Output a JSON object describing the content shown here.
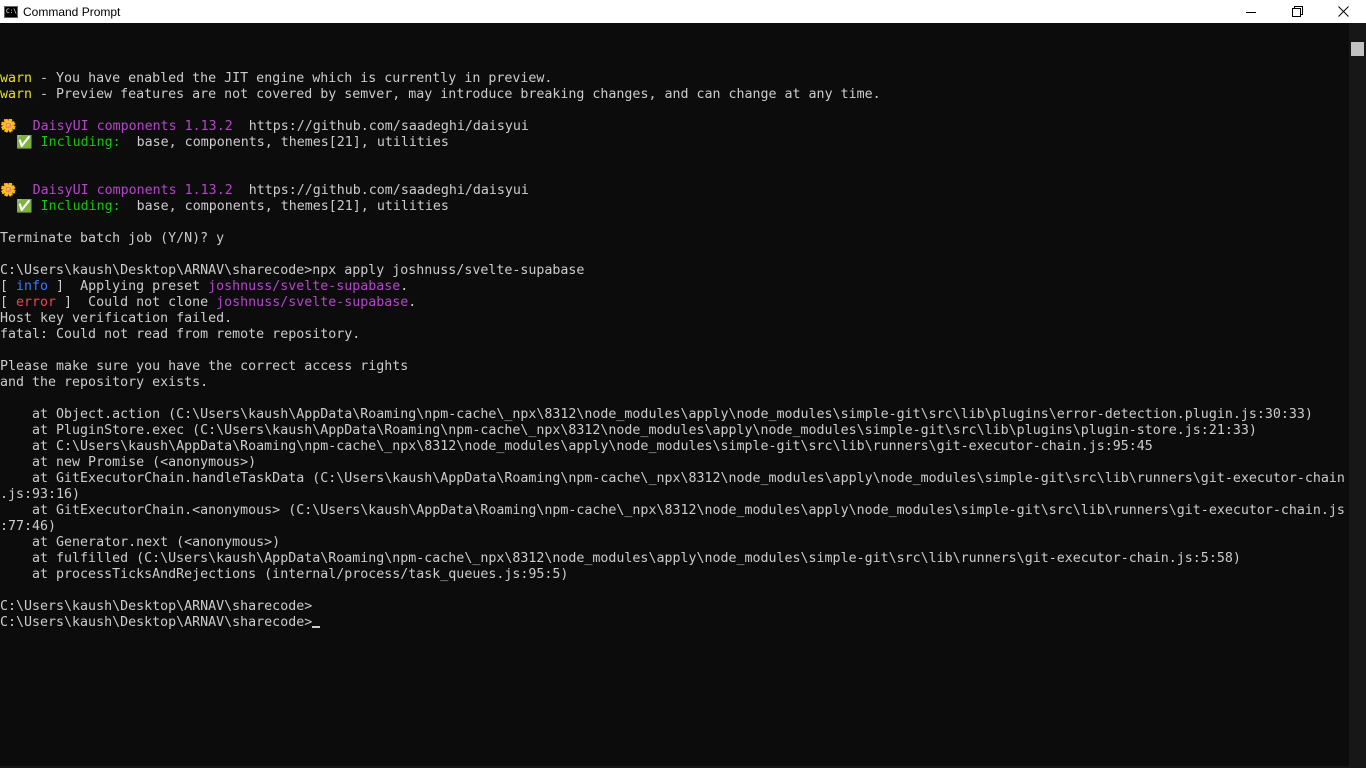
{
  "window": {
    "title": "Command Prompt",
    "icon": "cmd-icon",
    "icon_text": "C:\\",
    "controls": [
      "minimize-icon",
      "restore-icon",
      "close-icon"
    ]
  },
  "colors": {
    "background": "#0c0c0c",
    "text": "#cccccc",
    "warn": "#e5e510",
    "purple": "#b148c6",
    "green": "#16c60c",
    "blue": "#3b78ff",
    "red": "#e74856"
  },
  "console": {
    "lines": [
      [
        {
          "t": "warn",
          "c": "warn"
        },
        {
          "t": " - You have enabled the JIT engine which is currently in preview."
        }
      ],
      [
        {
          "t": "warn",
          "c": "warn"
        },
        {
          "t": " - Preview features are not covered by semver, may introduce breaking changes, and can change at any time."
        }
      ],
      [],
      [
        {
          "t": "🌼  DaisyUI components 1.13.2",
          "c": "purple"
        },
        {
          "t": "  https://github.com/saadeghi/daisyui"
        }
      ],
      [
        {
          "t": "  ✅ Including:",
          "c": "green"
        },
        {
          "t": "  base, components, themes[21], utilities"
        }
      ],
      [],
      [],
      [
        {
          "t": "🌼  DaisyUI components 1.13.2",
          "c": "purple"
        },
        {
          "t": "  https://github.com/saadeghi/daisyui"
        }
      ],
      [
        {
          "t": "  ✅ Including:",
          "c": "green"
        },
        {
          "t": "  base, components, themes[21], utilities"
        }
      ],
      [],
      [
        {
          "t": "Terminate batch job (Y/N)? y"
        }
      ],
      [],
      [
        {
          "t": "C:\\Users\\kaush\\Desktop\\ARNAV\\sharecode>npx apply joshnuss/svelte-supabase"
        }
      ],
      [
        {
          "t": "[ "
        },
        {
          "t": "info",
          "c": "blue"
        },
        {
          "t": " ]  Applying preset "
        },
        {
          "t": "joshnuss/svelte-supabase",
          "c": "purple"
        },
        {
          "t": "."
        }
      ],
      [
        {
          "t": "[ "
        },
        {
          "t": "error",
          "c": "red"
        },
        {
          "t": " ]  Could not clone "
        },
        {
          "t": "joshnuss/svelte-supabase",
          "c": "purple"
        },
        {
          "t": "."
        }
      ],
      [
        {
          "t": "Host key verification failed."
        }
      ],
      [
        {
          "t": "fatal: Could not read from remote repository."
        }
      ],
      [],
      [
        {
          "t": "Please make sure you have the correct access rights"
        }
      ],
      [
        {
          "t": "and the repository exists."
        }
      ],
      [],
      [
        {
          "t": "    at Object.action (C:\\Users\\kaush\\AppData\\Roaming\\npm-cache\\_npx\\8312\\node_modules\\apply\\node_modules\\simple-git\\src\\lib\\plugins\\error-detection.plugin.js:30:33)"
        }
      ],
      [
        {
          "t": "    at PluginStore.exec (C:\\Users\\kaush\\AppData\\Roaming\\npm-cache\\_npx\\8312\\node_modules\\apply\\node_modules\\simple-git\\src\\lib\\plugins\\plugin-store.js:21:33)"
        }
      ],
      [
        {
          "t": "    at C:\\Users\\kaush\\AppData\\Roaming\\npm-cache\\_npx\\8312\\node_modules\\apply\\node_modules\\simple-git\\src\\lib\\runners\\git-executor-chain.js:95:45"
        }
      ],
      [
        {
          "t": "    at new Promise (<anonymous>)"
        }
      ],
      [
        {
          "t": "    at GitExecutorChain.handleTaskData (C:\\Users\\kaush\\AppData\\Roaming\\npm-cache\\_npx\\8312\\node_modules\\apply\\node_modules\\simple-git\\src\\lib\\runners\\git-executor-chain"
        }
      ],
      [
        {
          "t": ".js:93:16)"
        }
      ],
      [
        {
          "t": "    at GitExecutorChain.<anonymous> (C:\\Users\\kaush\\AppData\\Roaming\\npm-cache\\_npx\\8312\\node_modules\\apply\\node_modules\\simple-git\\src\\lib\\runners\\git-executor-chain.js"
        }
      ],
      [
        {
          "t": ":77:46)"
        }
      ],
      [
        {
          "t": "    at Generator.next (<anonymous>)"
        }
      ],
      [
        {
          "t": "    at fulfilled (C:\\Users\\kaush\\AppData\\Roaming\\npm-cache\\_npx\\8312\\node_modules\\apply\\node_modules\\simple-git\\src\\lib\\runners\\git-executor-chain.js:5:58)"
        }
      ],
      [
        {
          "t": "    at processTicksAndRejections (internal/process/task_queues.js:95:5)"
        }
      ],
      [],
      [
        {
          "t": "C:\\Users\\kaush\\Desktop\\ARNAV\\sharecode>"
        }
      ]
    ],
    "prompt": "C:\\Users\\kaush\\Desktop\\ARNAV\\sharecode>"
  }
}
